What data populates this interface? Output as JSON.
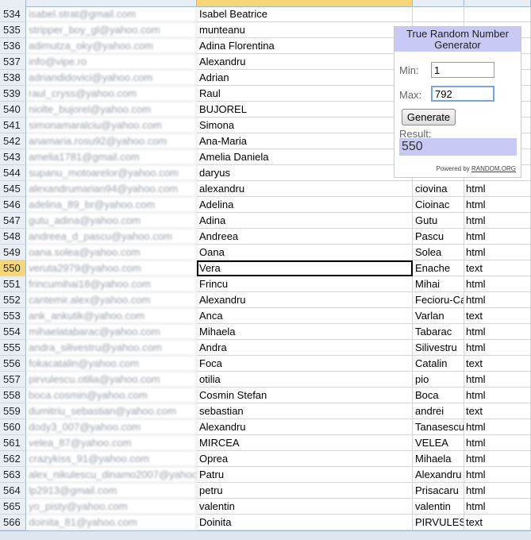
{
  "spreadsheet": {
    "selected_row": "550",
    "rows": [
      {
        "num": "534",
        "email": "isabel.strat@gmail.com",
        "first": "Isabel Beatrice",
        "last": "",
        "type": ""
      },
      {
        "num": "535",
        "email": "stripper_boy_gl@yahoo.com",
        "first": "munteanu",
        "last": "",
        "type": ""
      },
      {
        "num": "536",
        "email": "adimutza_oky@yahoo.com",
        "first": "Adina Florentina",
        "last": "",
        "type": ""
      },
      {
        "num": "537",
        "email": "info@vipe.ro",
        "first": "Alexandru",
        "last": "",
        "type": ""
      },
      {
        "num": "538",
        "email": "adriandidovici@yahoo.com",
        "first": "Adrian",
        "last": "",
        "type": ""
      },
      {
        "num": "539",
        "email": "raul_cryss@yahoo.com",
        "first": "Raul",
        "last": "",
        "type": ""
      },
      {
        "num": "540",
        "email": "niolte_bujorel@yahoo.com",
        "first": "BUJOREL",
        "last": "",
        "type": ""
      },
      {
        "num": "541",
        "email": "simonamaralciu@yahoo.com",
        "first": "Simona",
        "last": "",
        "type": ""
      },
      {
        "num": "542",
        "email": "anamaria.rosu92@yahoo.com",
        "first": "Ana-Maria",
        "last": "",
        "type": ""
      },
      {
        "num": "543",
        "email": "amelia1781@gmail.com",
        "first": "Amelia Daniela",
        "last": "",
        "type": ""
      },
      {
        "num": "544",
        "email": "supanu_motoarelor@yahoo.com",
        "first": "daryus",
        "last": "",
        "type": ""
      },
      {
        "num": "545",
        "email": "alexandrumarian94@yahoo.com",
        "first": "alexandru",
        "last": "ciovina",
        "type": "html"
      },
      {
        "num": "546",
        "email": "adelina_89_br@yahoo.com",
        "first": "Adelina",
        "last": "Cioinac",
        "type": "html"
      },
      {
        "num": "547",
        "email": "gutu_adina@yahoo.com",
        "first": "Adina",
        "last": "Gutu",
        "type": "html"
      },
      {
        "num": "548",
        "email": "andreea_d_pascu@yahoo.com",
        "first": "Andreea",
        "last": "Pascu",
        "type": "html"
      },
      {
        "num": "549",
        "email": "oana.solea@yahoo.com",
        "first": "Oana",
        "last": "Solea",
        "type": "html"
      },
      {
        "num": "550",
        "email": "veruta2979@yahoo.com",
        "first": "Vera",
        "last": "Enache",
        "type": "text"
      },
      {
        "num": "551",
        "email": "frincumihai18@yahoo.com",
        "first": "Frincu",
        "last": "Mihai",
        "type": "html"
      },
      {
        "num": "552",
        "email": "cantemir.alex@yahoo.com",
        "first": "Alexandru",
        "last": "Fecioru-Ca",
        "type": "html"
      },
      {
        "num": "553",
        "email": "ank_ankutik@yahoo.com",
        "first": "Anca",
        "last": "Varlan",
        "type": "text"
      },
      {
        "num": "554",
        "email": "mihaelatabarac@yahoo.com",
        "first": "Mihaela",
        "last": "Tabarac",
        "type": "html"
      },
      {
        "num": "555",
        "email": "andra_silivestru@yahoo.com",
        "first": "Andra",
        "last": "Silivestru",
        "type": "html"
      },
      {
        "num": "556",
        "email": "fokacatalin@yahoo.com",
        "first": "Foca",
        "last": "Catalin",
        "type": "text"
      },
      {
        "num": "557",
        "email": "pirvulescu.otilia@yahoo.com",
        "first": "otilia",
        "last": "pio",
        "type": "html"
      },
      {
        "num": "558",
        "email": "boca.cosmin@yahoo.com",
        "first": "Cosmin Stefan",
        "last": "Boca",
        "type": "html"
      },
      {
        "num": "559",
        "email": "dumitriu_sebastian@yahoo.com",
        "first": "sebastian",
        "last": "andrei",
        "type": "text"
      },
      {
        "num": "560",
        "email": "dody3_007@yahoo.com",
        "first": "Alexandru",
        "last": "Tanasescu",
        "type": "html"
      },
      {
        "num": "561",
        "email": "velea_87@yahoo.com",
        "first": "MIRCEA",
        "last": "VELEA",
        "type": "html"
      },
      {
        "num": "562",
        "email": "crazykiss_91@yahoo.com",
        "first": "Oprea",
        "last": "Mihaela",
        "type": "html"
      },
      {
        "num": "563",
        "email": "alex_nikulescu_dinamo2007@yahoo.com",
        "first": "Patru",
        "last": "Alexandru",
        "type": "html"
      },
      {
        "num": "564",
        "email": "lp2913@gmail.com",
        "first": "petru",
        "last": "Prisacaru",
        "type": "html"
      },
      {
        "num": "565",
        "email": "yo_pisty@yahoo.com",
        "first": "valentin",
        "last": "valentin",
        "type": "html"
      },
      {
        "num": "566",
        "email": "doinita_81@yahoo.com",
        "first": "Doinita",
        "last": "PIRVULESC",
        "type": "text"
      }
    ]
  },
  "widget": {
    "title": "True Random Number Generator",
    "min_label": "Min:",
    "min_value": "1",
    "max_label": "Max:",
    "max_value": "792",
    "generate_label": "Generate",
    "result_label": "Result:",
    "result_value": "550",
    "powered_prefix": "Powered by",
    "powered_link": "RANDOM.ORG",
    "title_bg": "#c9c9f5"
  }
}
